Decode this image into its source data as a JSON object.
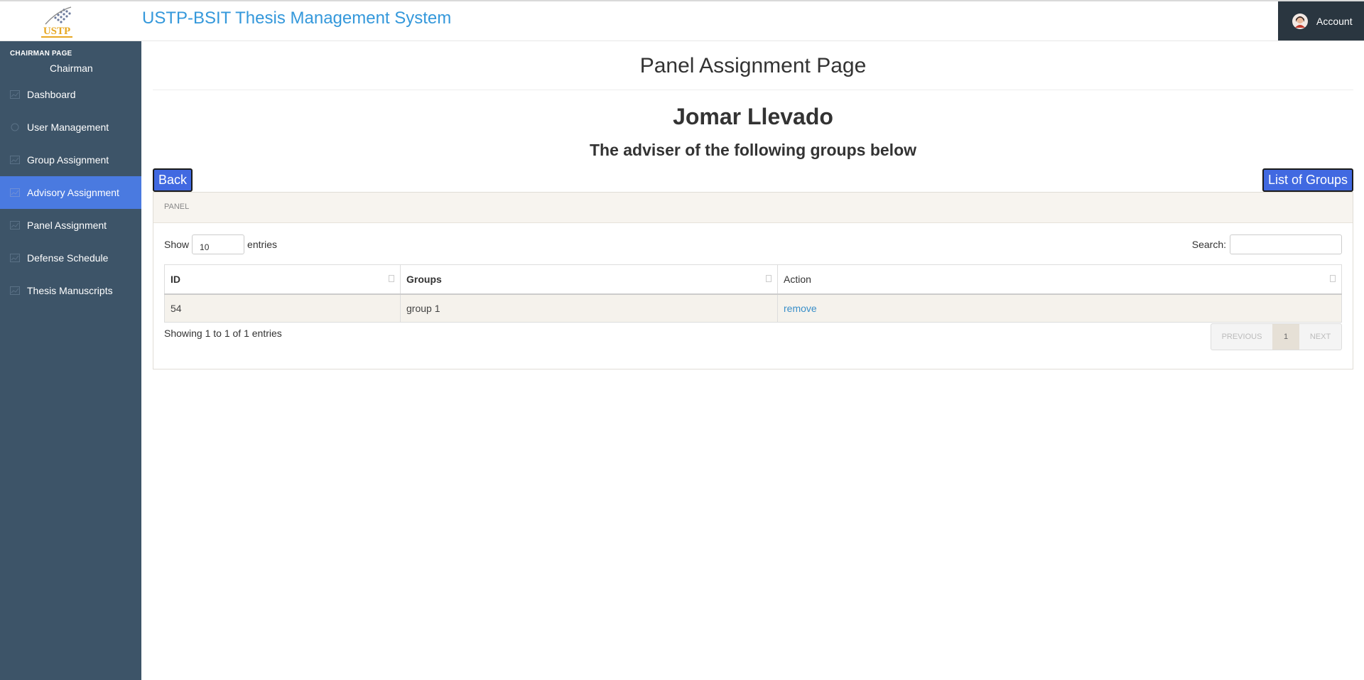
{
  "header": {
    "logo_text": "USTP",
    "app_title": "USTP-BSIT Thesis Management System",
    "account_label": "Account"
  },
  "sidebar": {
    "heading": "CHAIRMAN PAGE",
    "user_role": "Chairman",
    "items": [
      {
        "label": "Dashboard",
        "icon": "chart-icon"
      },
      {
        "label": "User Management",
        "icon": "circle-icon"
      },
      {
        "label": "Group Assignment",
        "icon": "chart-icon"
      },
      {
        "label": "Advisory Assignment",
        "icon": "chart-icon",
        "active": true
      },
      {
        "label": "Panel Assignment",
        "icon": "chart-icon"
      },
      {
        "label": "Defense Schedule",
        "icon": "chart-icon"
      },
      {
        "label": "Thesis Manuscripts",
        "icon": "chart-icon"
      }
    ],
    "active_color": "#4a7ae0",
    "background": "#3d5468"
  },
  "main": {
    "page_title": "Panel Assignment Page",
    "person_name": "Jomar Llevado",
    "subtitle": "The adviser of the following groups below",
    "back_label": "Back",
    "list_groups_label": "List of Groups",
    "panel_heading": "PANEL",
    "show_label": "Show",
    "entries_value": "10",
    "entries_label": "entries",
    "search_label": "Search:",
    "search_value": "",
    "columns": [
      "ID",
      "Groups",
      "Action"
    ],
    "rows": [
      {
        "id": "54",
        "group": "group 1",
        "action": "remove"
      }
    ],
    "info": "Showing 1 to 1 of 1 entries",
    "pager": {
      "previous": "PREVIOUS",
      "page": "1",
      "next": "NEXT"
    }
  }
}
